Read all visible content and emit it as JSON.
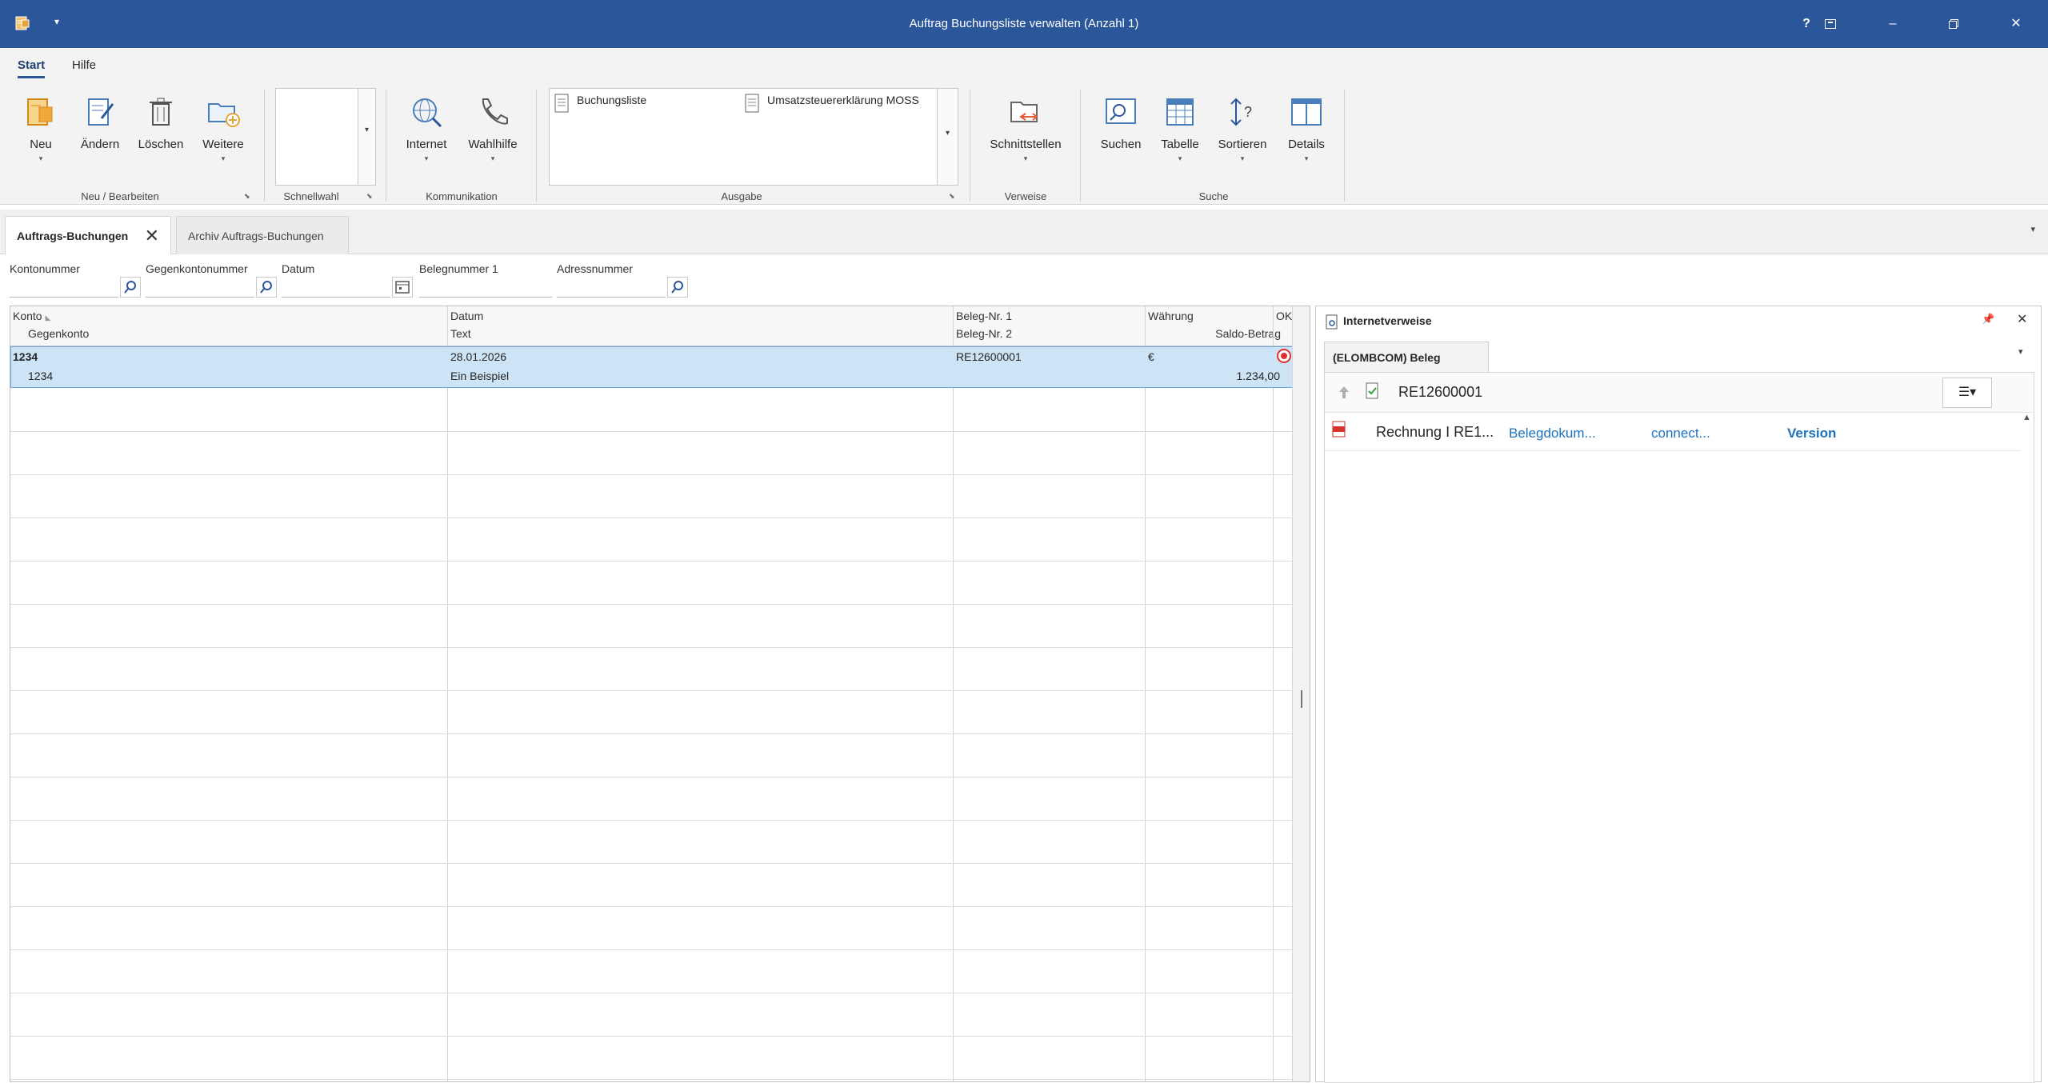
{
  "window": {
    "title": "Auftrag Buchungsliste verwalten (Anzahl 1)",
    "help": "?",
    "minimize": "–",
    "close": "✕"
  },
  "ribbon_tabs": [
    "Start",
    "Hilfe"
  ],
  "ribbon": {
    "neu": "Neu",
    "aendern": "Ändern",
    "loeschen": "Löschen",
    "weitere": "Weitere",
    "group_neu": "Neu / Bearbeiten",
    "group_schnellwahl": "Schnellwahl",
    "internet": "Internet",
    "wahlhilfe": "Wahlhilfe",
    "group_kommunikation": "Kommunikation",
    "ausgabe_items": [
      "Buchungsliste",
      "Umsatzsteuererklärung MOSS"
    ],
    "group_ausgabe": "Ausgabe",
    "schnittstellen": "Schnittstellen",
    "group_verweise": "Verweise",
    "suchen": "Suchen",
    "tabelle": "Tabelle",
    "sortieren": "Sortieren",
    "details": "Details",
    "group_suche": "Suche"
  },
  "doc_tabs": {
    "active": "Auftrags-Buchungen",
    "inactive": "Archiv Auftrags-Buchungen"
  },
  "filters": {
    "kontonummer": "Kontonummer",
    "gegenkontonummer": "Gegenkontonummer",
    "datum": "Datum",
    "belegnummer1": "Belegnummer 1",
    "adressnummer": "Adressnummer"
  },
  "grid": {
    "headers": {
      "konto": "Konto",
      "gegenkonto": "Gegenkonto",
      "datum": "Datum",
      "text": "Text",
      "beleg1": "Beleg-Nr. 1",
      "beleg2": "Beleg-Nr. 2",
      "waehrung": "Währung",
      "saldo": "Saldo-Betrag",
      "ok": "OK"
    },
    "row": {
      "konto": "1234",
      "gegenkonto": "1234",
      "datum": "28.01.2026",
      "text": "Ein Beispiel",
      "beleg1": "RE12600001",
      "beleg2": "",
      "waehrung": "€",
      "saldo": "1.234,00"
    }
  },
  "panel": {
    "title": "Internetverweise",
    "tab": "(ELOMBCOM) Beleg",
    "beleg": "RE12600001",
    "entry": {
      "name": "Rechnung I RE1...",
      "col2": "Belegdokum...",
      "col3": "connect...",
      "col4": "Version"
    }
  },
  "colors": {
    "titlebar": "#2b579a",
    "selection": "#cde3f6",
    "link": "#1e73be"
  }
}
